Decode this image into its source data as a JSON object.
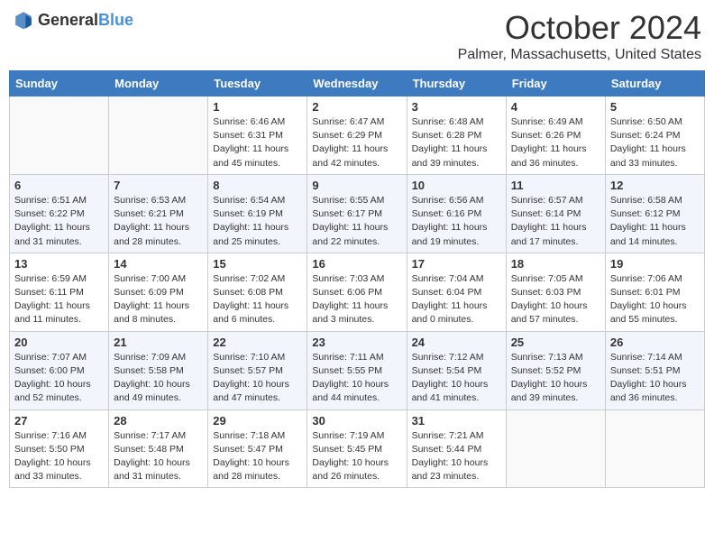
{
  "header": {
    "logo_general": "General",
    "logo_blue": "Blue",
    "month": "October 2024",
    "location": "Palmer, Massachusetts, United States"
  },
  "days_of_week": [
    "Sunday",
    "Monday",
    "Tuesday",
    "Wednesday",
    "Thursday",
    "Friday",
    "Saturday"
  ],
  "weeks": [
    [
      {
        "day": "",
        "info": ""
      },
      {
        "day": "",
        "info": ""
      },
      {
        "day": "1",
        "info": "Sunrise: 6:46 AM\nSunset: 6:31 PM\nDaylight: 11 hours and 45 minutes."
      },
      {
        "day": "2",
        "info": "Sunrise: 6:47 AM\nSunset: 6:29 PM\nDaylight: 11 hours and 42 minutes."
      },
      {
        "day": "3",
        "info": "Sunrise: 6:48 AM\nSunset: 6:28 PM\nDaylight: 11 hours and 39 minutes."
      },
      {
        "day": "4",
        "info": "Sunrise: 6:49 AM\nSunset: 6:26 PM\nDaylight: 11 hours and 36 minutes."
      },
      {
        "day": "5",
        "info": "Sunrise: 6:50 AM\nSunset: 6:24 PM\nDaylight: 11 hours and 33 minutes."
      }
    ],
    [
      {
        "day": "6",
        "info": "Sunrise: 6:51 AM\nSunset: 6:22 PM\nDaylight: 11 hours and 31 minutes."
      },
      {
        "day": "7",
        "info": "Sunrise: 6:53 AM\nSunset: 6:21 PM\nDaylight: 11 hours and 28 minutes."
      },
      {
        "day": "8",
        "info": "Sunrise: 6:54 AM\nSunset: 6:19 PM\nDaylight: 11 hours and 25 minutes."
      },
      {
        "day": "9",
        "info": "Sunrise: 6:55 AM\nSunset: 6:17 PM\nDaylight: 11 hours and 22 minutes."
      },
      {
        "day": "10",
        "info": "Sunrise: 6:56 AM\nSunset: 6:16 PM\nDaylight: 11 hours and 19 minutes."
      },
      {
        "day": "11",
        "info": "Sunrise: 6:57 AM\nSunset: 6:14 PM\nDaylight: 11 hours and 17 minutes."
      },
      {
        "day": "12",
        "info": "Sunrise: 6:58 AM\nSunset: 6:12 PM\nDaylight: 11 hours and 14 minutes."
      }
    ],
    [
      {
        "day": "13",
        "info": "Sunrise: 6:59 AM\nSunset: 6:11 PM\nDaylight: 11 hours and 11 minutes."
      },
      {
        "day": "14",
        "info": "Sunrise: 7:00 AM\nSunset: 6:09 PM\nDaylight: 11 hours and 8 minutes."
      },
      {
        "day": "15",
        "info": "Sunrise: 7:02 AM\nSunset: 6:08 PM\nDaylight: 11 hours and 6 minutes."
      },
      {
        "day": "16",
        "info": "Sunrise: 7:03 AM\nSunset: 6:06 PM\nDaylight: 11 hours and 3 minutes."
      },
      {
        "day": "17",
        "info": "Sunrise: 7:04 AM\nSunset: 6:04 PM\nDaylight: 11 hours and 0 minutes."
      },
      {
        "day": "18",
        "info": "Sunrise: 7:05 AM\nSunset: 6:03 PM\nDaylight: 10 hours and 57 minutes."
      },
      {
        "day": "19",
        "info": "Sunrise: 7:06 AM\nSunset: 6:01 PM\nDaylight: 10 hours and 55 minutes."
      }
    ],
    [
      {
        "day": "20",
        "info": "Sunrise: 7:07 AM\nSunset: 6:00 PM\nDaylight: 10 hours and 52 minutes."
      },
      {
        "day": "21",
        "info": "Sunrise: 7:09 AM\nSunset: 5:58 PM\nDaylight: 10 hours and 49 minutes."
      },
      {
        "day": "22",
        "info": "Sunrise: 7:10 AM\nSunset: 5:57 PM\nDaylight: 10 hours and 47 minutes."
      },
      {
        "day": "23",
        "info": "Sunrise: 7:11 AM\nSunset: 5:55 PM\nDaylight: 10 hours and 44 minutes."
      },
      {
        "day": "24",
        "info": "Sunrise: 7:12 AM\nSunset: 5:54 PM\nDaylight: 10 hours and 41 minutes."
      },
      {
        "day": "25",
        "info": "Sunrise: 7:13 AM\nSunset: 5:52 PM\nDaylight: 10 hours and 39 minutes."
      },
      {
        "day": "26",
        "info": "Sunrise: 7:14 AM\nSunset: 5:51 PM\nDaylight: 10 hours and 36 minutes."
      }
    ],
    [
      {
        "day": "27",
        "info": "Sunrise: 7:16 AM\nSunset: 5:50 PM\nDaylight: 10 hours and 33 minutes."
      },
      {
        "day": "28",
        "info": "Sunrise: 7:17 AM\nSunset: 5:48 PM\nDaylight: 10 hours and 31 minutes."
      },
      {
        "day": "29",
        "info": "Sunrise: 7:18 AM\nSunset: 5:47 PM\nDaylight: 10 hours and 28 minutes."
      },
      {
        "day": "30",
        "info": "Sunrise: 7:19 AM\nSunset: 5:45 PM\nDaylight: 10 hours and 26 minutes."
      },
      {
        "day": "31",
        "info": "Sunrise: 7:21 AM\nSunset: 5:44 PM\nDaylight: 10 hours and 23 minutes."
      },
      {
        "day": "",
        "info": ""
      },
      {
        "day": "",
        "info": ""
      }
    ]
  ]
}
